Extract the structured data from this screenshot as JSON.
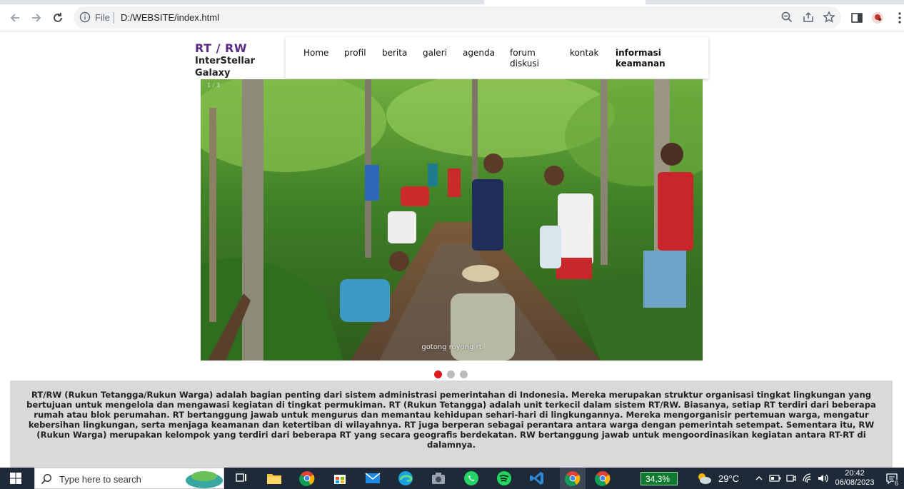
{
  "browser": {
    "file_label": "File",
    "url": "D:/WEBSITE/index.html"
  },
  "site": {
    "brand_title": "RT / RW",
    "brand_sub_line1": "InterStellar",
    "brand_sub_line2": "Galaxy"
  },
  "nav": {
    "items": [
      {
        "label": "Home"
      },
      {
        "label": "profil"
      },
      {
        "label": "berita"
      },
      {
        "label": "galeri"
      },
      {
        "label": "agenda"
      },
      {
        "label_line1": "forum",
        "label_line2": "diskusi"
      },
      {
        "label": "kontak"
      },
      {
        "label_line1": "informasi",
        "label_line2": "keamanan"
      }
    ]
  },
  "slider": {
    "counter": "1 / 3",
    "caption": "gotong royong rt",
    "slide_count": 3,
    "active_index": 0
  },
  "about": {
    "text": "RT/RW (Rukun Tetangga/Rukun Warga) adalah bagian penting dari sistem administrasi pemerintahan di Indonesia. Mereka merupakan struktur organisasi tingkat lingkungan yang bertujuan untuk mengelola dan mengawasi kegiatan di tingkat permukiman. RT (Rukun Tetangga) adalah unit terkecil dalam sistem RT/RW. Biasanya, setiap RT terdiri dari beberapa rumah atau blok perumahan. RT bertanggung jawab untuk mengurus dan memantau kehidupan sehari-hari di lingkungannya. Mereka mengorganisir pertemuan warga, mengatur kebersihan lingkungan, serta menjaga keamanan dan ketertiban di wilayahnya. RT juga berperan sebagai perantara antara warga dengan pemerintah setempat. Sementara itu, RW (Rukun Warga) merupakan kelompok yang terdiri dari beberapa RT yang secara geografis berdekatan. RW bertanggung jawab untuk mengoordinasikan kegiatan antara RT-RT di dalamnya."
  },
  "taskbar": {
    "search_placeholder": "Type here to search",
    "battery": "34,3%",
    "temperature": "29°C",
    "time": "20:42",
    "date": "06/08/2023",
    "notification_count": "6"
  },
  "colors": {
    "brand": "#5b2a86",
    "dot_active": "#e0171b",
    "dot_inactive": "#bbbbbb",
    "about_bg": "#d9d9d9",
    "taskbar_bg": "#1f2a38"
  }
}
